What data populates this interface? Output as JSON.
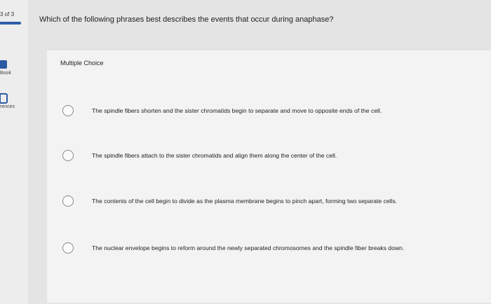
{
  "progress": {
    "counter": "3 of 3"
  },
  "rail": {
    "book_label": "Book",
    "references_label": "rences"
  },
  "question": {
    "text": "Which of the following phrases best describes the events that occur during anaphase?"
  },
  "answer_area": {
    "type_label": "Multiple Choice"
  },
  "choices": [
    {
      "text": "The spindle fibers shorten and the sister chromatids begin to separate and move to opposite ends of the cell."
    },
    {
      "text": "The spindle fibers attach to the sister chromatids and align them along the center of the cell."
    },
    {
      "text": "The contents of the cell begin to divide as the plasma membrane begins to pinch apart, forming two separate cells."
    },
    {
      "text": "The nuclear envelope begins to reform around the newly separated chromosomes and the spindle fiber breaks down."
    }
  ],
  "colors": {
    "accent": "#2e5ea8",
    "background": "#e4e4e4",
    "card": "#f3f3f3"
  }
}
